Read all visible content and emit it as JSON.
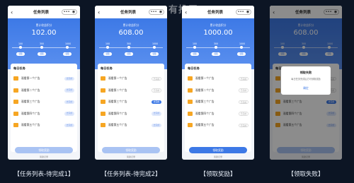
{
  "watermark": "有推无",
  "panels": [
    {
      "caption": "【任务列表-待完成1】",
      "title": "任务列表",
      "hero_label": "累计收益积分",
      "hero_value": "102.00",
      "ticks": [
        "100",
        "300",
        "1000"
      ],
      "pills": [
        "领取",
        "领取",
        "领取"
      ],
      "daily": "每日任务",
      "rows": [
        {
          "text": "观看第一个广告",
          "btn": "去完成",
          "state": "done"
        },
        {
          "text": "观看第二个广告",
          "btn": "去完成",
          "state": "done"
        },
        {
          "text": "观看第三个广告",
          "btn": "去完成",
          "state": "done"
        },
        {
          "text": "观看第四个广告",
          "btn": "去完成",
          "state": "done"
        },
        {
          "text": "观看第五个广告",
          "btn": "去完成",
          "state": "done"
        }
      ],
      "claim_label": "领取奖励",
      "claim_enabled": false,
      "claim_sub": "奖励记录"
    },
    {
      "caption": "【任务列表-待完成2】",
      "title": "任务列表",
      "hero_label": "累计收益积分",
      "hero_value": "608.00",
      "ticks": [
        "100",
        "300",
        "1000"
      ],
      "pills": [
        "领取",
        "领取",
        "领取"
      ],
      "daily": "每日任务",
      "rows": [
        {
          "text": "观看第一个广告",
          "btn": "已完成",
          "state": "ghost"
        },
        {
          "text": "观看第二个广告",
          "btn": "已完成",
          "state": "ghost"
        },
        {
          "text": "观看第三个广告",
          "btn": "去完成",
          "state": "active"
        },
        {
          "text": "观看第四个广告",
          "btn": "去完成",
          "state": "done"
        },
        {
          "text": "观看第五个广告",
          "btn": "去完成",
          "state": "done"
        }
      ],
      "claim_label": "领取奖励",
      "claim_enabled": false,
      "claim_sub": "奖励记录"
    },
    {
      "caption": "【领取奖励】",
      "title": "任务列表",
      "hero_label": "累计收益积分",
      "hero_value": "1000.00",
      "ticks": [
        "100",
        "300",
        "1000"
      ],
      "pills": [
        "领取",
        "领取",
        "领取"
      ],
      "daily": "每日任务",
      "rows": [
        {
          "text": "观看第一个广告",
          "btn": "已完成",
          "state": "ghost"
        },
        {
          "text": "观看第二个广告",
          "btn": "已完成",
          "state": "ghost"
        },
        {
          "text": "观看第三个广告",
          "btn": "已完成",
          "state": "ghost"
        },
        {
          "text": "观看第四个广告",
          "btn": "已完成",
          "state": "ghost"
        },
        {
          "text": "观看第五个广告",
          "btn": "已完成",
          "state": "ghost"
        }
      ],
      "claim_label": "领取奖励",
      "claim_enabled": true,
      "claim_sub": "奖励记录"
    },
    {
      "caption": "【领取失败】",
      "title": "任务列表",
      "hero_label": "累计收益积分",
      "hero_value": "608.00",
      "ticks": [
        "100",
        "300",
        "1000"
      ],
      "pills": [
        "领取",
        "领取",
        "领取"
      ],
      "daily": "每日任务",
      "rows": [
        {
          "text": "观看第一个广告",
          "btn": "已完成",
          "state": "ghost"
        },
        {
          "text": "观看第二个广告",
          "btn": "已完成",
          "state": "ghost"
        },
        {
          "text": "观看第三个广告",
          "btn": "去完成",
          "state": "active"
        },
        {
          "text": "观看第四个广告",
          "btn": "去完成",
          "state": "done"
        },
        {
          "text": "观看第五个广告",
          "btn": "去完成",
          "state": "done"
        }
      ],
      "claim_label": "领取奖励",
      "claim_enabled": false,
      "claim_sub": "奖励记录",
      "modal": {
        "title": "领取失败",
        "body": "每日任务完成后方可领取奖励",
        "button": "确定"
      }
    }
  ],
  "colors": {
    "accent": "#3d79e6",
    "reward_icon": "#f6a623"
  },
  "icons": {
    "back": "back-arrow-icon",
    "more": "more-dots-icon",
    "close": "target-close-icon",
    "row": "gift-icon"
  }
}
